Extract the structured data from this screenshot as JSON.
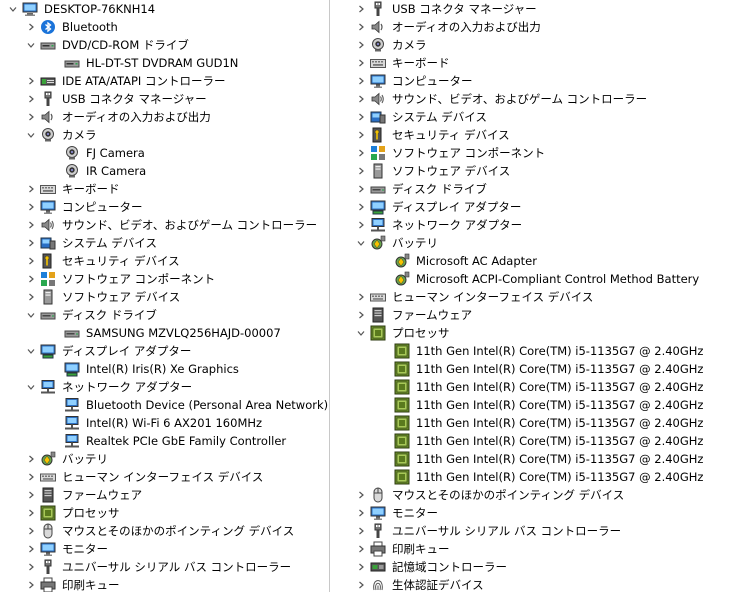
{
  "left": {
    "items": [
      {
        "depth": 0,
        "state": "expanded",
        "icon": "computer-icon",
        "label": "DESKTOP-76KNH14"
      },
      {
        "depth": 1,
        "state": "collapsed",
        "icon": "bluetooth-icon",
        "label": "Bluetooth"
      },
      {
        "depth": 1,
        "state": "expanded",
        "icon": "dvd-drive-icon",
        "label": "DVD/CD-ROM ドライブ"
      },
      {
        "depth": 2,
        "state": "none",
        "icon": "dvd-drive-icon",
        "label": "HL-DT-ST DVDRAM GUD1N"
      },
      {
        "depth": 1,
        "state": "collapsed",
        "icon": "ide-controller-icon",
        "label": "IDE ATA/ATAPI コントローラー"
      },
      {
        "depth": 1,
        "state": "collapsed",
        "icon": "usb-connector-icon",
        "label": "USB コネクタ マネージャー"
      },
      {
        "depth": 1,
        "state": "collapsed",
        "icon": "speaker-icon",
        "label": "オーディオの入力および出力"
      },
      {
        "depth": 1,
        "state": "expanded",
        "icon": "camera-icon",
        "label": "カメラ"
      },
      {
        "depth": 2,
        "state": "none",
        "icon": "camera-icon",
        "label": "FJ Camera"
      },
      {
        "depth": 2,
        "state": "none",
        "icon": "camera-icon",
        "label": "IR Camera"
      },
      {
        "depth": 1,
        "state": "collapsed",
        "icon": "keyboard-icon",
        "label": "キーボード"
      },
      {
        "depth": 1,
        "state": "collapsed",
        "icon": "monitor-icon",
        "label": "コンピューター"
      },
      {
        "depth": 1,
        "state": "collapsed",
        "icon": "sound-icon",
        "label": "サウンド、ビデオ、およびゲーム コントローラー"
      },
      {
        "depth": 1,
        "state": "collapsed",
        "icon": "system-device-icon",
        "label": "システム デバイス"
      },
      {
        "depth": 1,
        "state": "collapsed",
        "icon": "security-device-icon",
        "label": "セキュリティ デバイス"
      },
      {
        "depth": 1,
        "state": "collapsed",
        "icon": "software-component-icon",
        "label": "ソフトウェア コンポーネント"
      },
      {
        "depth": 1,
        "state": "collapsed",
        "icon": "software-device-icon",
        "label": "ソフトウェア デバイス"
      },
      {
        "depth": 1,
        "state": "expanded",
        "icon": "disk-drive-icon",
        "label": "ディスク ドライブ"
      },
      {
        "depth": 2,
        "state": "none",
        "icon": "disk-drive-icon",
        "label": "SAMSUNG MZVLQ256HAJD-00007"
      },
      {
        "depth": 1,
        "state": "expanded",
        "icon": "display-adapter-icon",
        "label": "ディスプレイ アダプター"
      },
      {
        "depth": 2,
        "state": "none",
        "icon": "display-adapter-icon",
        "label": "Intel(R) Iris(R) Xe Graphics"
      },
      {
        "depth": 1,
        "state": "expanded",
        "icon": "network-adapter-icon",
        "label": "ネットワーク アダプター"
      },
      {
        "depth": 2,
        "state": "none",
        "icon": "network-adapter-icon",
        "label": "Bluetooth Device (Personal Area Network)"
      },
      {
        "depth": 2,
        "state": "none",
        "icon": "network-adapter-icon",
        "label": "Intel(R) Wi-Fi 6 AX201 160MHz"
      },
      {
        "depth": 2,
        "state": "none",
        "icon": "network-adapter-icon",
        "label": "Realtek PCIe GbE Family Controller"
      },
      {
        "depth": 1,
        "state": "collapsed",
        "icon": "battery-icon",
        "label": "バッテリ"
      },
      {
        "depth": 1,
        "state": "collapsed",
        "icon": "hid-icon",
        "label": "ヒューマン インターフェイス デバイス"
      },
      {
        "depth": 1,
        "state": "collapsed",
        "icon": "firmware-icon",
        "label": "ファームウェア"
      },
      {
        "depth": 1,
        "state": "collapsed",
        "icon": "processor-icon",
        "label": "プロセッサ"
      },
      {
        "depth": 1,
        "state": "collapsed",
        "icon": "mouse-icon",
        "label": "マウスとそのほかのポインティング デバイス"
      },
      {
        "depth": 1,
        "state": "collapsed",
        "icon": "monitor-icon",
        "label": "モニター"
      },
      {
        "depth": 1,
        "state": "collapsed",
        "icon": "usb-controller-icon",
        "label": "ユニバーサル シリアル バス コントローラー"
      },
      {
        "depth": 1,
        "state": "collapsed",
        "icon": "print-queue-icon",
        "label": "印刷キュー"
      }
    ]
  },
  "right": {
    "items": [
      {
        "depth": 1,
        "state": "collapsed",
        "icon": "usb-connector-icon",
        "label": "USB コネクタ マネージャー"
      },
      {
        "depth": 1,
        "state": "collapsed",
        "icon": "speaker-icon",
        "label": "オーディオの入力および出力"
      },
      {
        "depth": 1,
        "state": "collapsed",
        "icon": "camera-icon",
        "label": "カメラ"
      },
      {
        "depth": 1,
        "state": "collapsed",
        "icon": "keyboard-icon",
        "label": "キーボード"
      },
      {
        "depth": 1,
        "state": "collapsed",
        "icon": "monitor-icon",
        "label": "コンピューター"
      },
      {
        "depth": 1,
        "state": "collapsed",
        "icon": "sound-icon",
        "label": "サウンド、ビデオ、およびゲーム コントローラー"
      },
      {
        "depth": 1,
        "state": "collapsed",
        "icon": "system-device-icon",
        "label": "システム デバイス"
      },
      {
        "depth": 1,
        "state": "collapsed",
        "icon": "security-device-icon",
        "label": "セキュリティ デバイス"
      },
      {
        "depth": 1,
        "state": "collapsed",
        "icon": "software-component-icon",
        "label": "ソフトウェア コンポーネント"
      },
      {
        "depth": 1,
        "state": "collapsed",
        "icon": "software-device-icon",
        "label": "ソフトウェア デバイス"
      },
      {
        "depth": 1,
        "state": "collapsed",
        "icon": "disk-drive-icon",
        "label": "ディスク ドライブ"
      },
      {
        "depth": 1,
        "state": "collapsed",
        "icon": "display-adapter-icon",
        "label": "ディスプレイ アダプター"
      },
      {
        "depth": 1,
        "state": "collapsed",
        "icon": "network-adapter-icon",
        "label": "ネットワーク アダプター"
      },
      {
        "depth": 1,
        "state": "expanded",
        "icon": "battery-icon",
        "label": "バッテリ"
      },
      {
        "depth": 2,
        "state": "none",
        "icon": "battery-icon",
        "label": "Microsoft AC Adapter"
      },
      {
        "depth": 2,
        "state": "none",
        "icon": "battery-icon",
        "label": "Microsoft ACPI-Compliant Control Method Battery"
      },
      {
        "depth": 1,
        "state": "collapsed",
        "icon": "hid-icon",
        "label": "ヒューマン インターフェイス デバイス"
      },
      {
        "depth": 1,
        "state": "collapsed",
        "icon": "firmware-icon",
        "label": "ファームウェア"
      },
      {
        "depth": 1,
        "state": "expanded",
        "icon": "processor-icon",
        "label": "プロセッサ"
      },
      {
        "depth": 2,
        "state": "none",
        "icon": "processor-icon",
        "label": "11th Gen Intel(R) Core(TM) i5-1135G7 @ 2.40GHz"
      },
      {
        "depth": 2,
        "state": "none",
        "icon": "processor-icon",
        "label": "11th Gen Intel(R) Core(TM) i5-1135G7 @ 2.40GHz"
      },
      {
        "depth": 2,
        "state": "none",
        "icon": "processor-icon",
        "label": "11th Gen Intel(R) Core(TM) i5-1135G7 @ 2.40GHz"
      },
      {
        "depth": 2,
        "state": "none",
        "icon": "processor-icon",
        "label": "11th Gen Intel(R) Core(TM) i5-1135G7 @ 2.40GHz"
      },
      {
        "depth": 2,
        "state": "none",
        "icon": "processor-icon",
        "label": "11th Gen Intel(R) Core(TM) i5-1135G7 @ 2.40GHz"
      },
      {
        "depth": 2,
        "state": "none",
        "icon": "processor-icon",
        "label": "11th Gen Intel(R) Core(TM) i5-1135G7 @ 2.40GHz"
      },
      {
        "depth": 2,
        "state": "none",
        "icon": "processor-icon",
        "label": "11th Gen Intel(R) Core(TM) i5-1135G7 @ 2.40GHz"
      },
      {
        "depth": 2,
        "state": "none",
        "icon": "processor-icon",
        "label": "11th Gen Intel(R) Core(TM) i5-1135G7 @ 2.40GHz"
      },
      {
        "depth": 1,
        "state": "collapsed",
        "icon": "mouse-icon",
        "label": "マウスとそのほかのポインティング デバイス"
      },
      {
        "depth": 1,
        "state": "collapsed",
        "icon": "monitor-icon",
        "label": "モニター"
      },
      {
        "depth": 1,
        "state": "collapsed",
        "icon": "usb-controller-icon",
        "label": "ユニバーサル シリアル バス コントローラー"
      },
      {
        "depth": 1,
        "state": "collapsed",
        "icon": "print-queue-icon",
        "label": "印刷キュー"
      },
      {
        "depth": 1,
        "state": "collapsed",
        "icon": "storage-controller-icon",
        "label": "記憶域コントローラー"
      },
      {
        "depth": 1,
        "state": "collapsed",
        "icon": "biometric-icon",
        "label": "生体認証デバイス"
      }
    ]
  }
}
